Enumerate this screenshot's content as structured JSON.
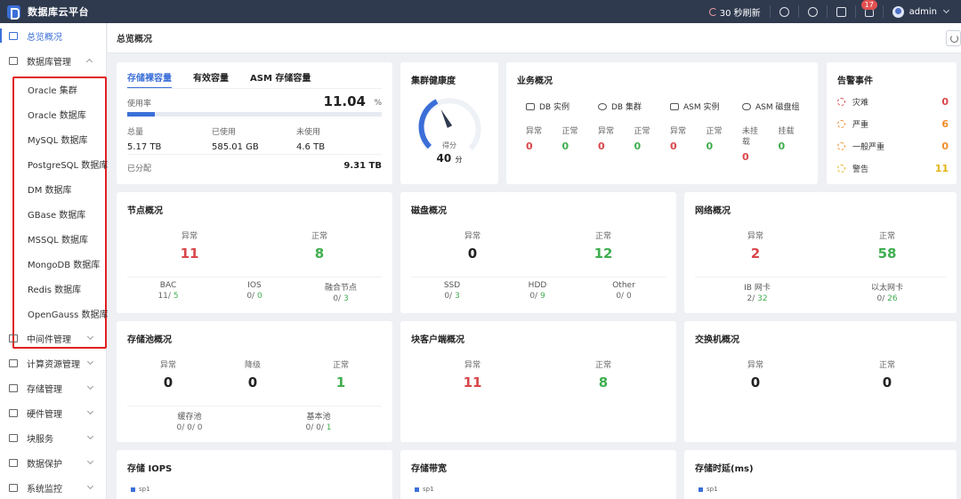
{
  "app": {
    "title": "数据库云平台"
  },
  "topbar": {
    "refresh": "30 秒刷新",
    "badge": "17",
    "user": "admin"
  },
  "sidebar": {
    "items_top": [
      {
        "label": "总览概况",
        "active": true
      },
      {
        "label": "数据库管理",
        "expanded": true
      }
    ],
    "db_submenu": [
      "Oracle 集群",
      "Oracle 数据库",
      "MySQL 数据库",
      "PostgreSQL 数据库",
      "DM 数据库",
      "GBase 数据库",
      "MSSQL 数据库",
      "MongoDB 数据库",
      "Redis 数据库",
      "OpenGauss 数据库"
    ],
    "items_bottom": [
      "中间件管理",
      "计算资源管理",
      "存储管理",
      "硬件管理",
      "块服务",
      "数据保护",
      "系统监控"
    ]
  },
  "main": {
    "title": "总览概况"
  },
  "storage": {
    "tabs": [
      "存储裸容量",
      "有效容量",
      "ASM 存储容量"
    ],
    "usage_label": "使用率",
    "usage_value": "11.04",
    "usage_unit": "%",
    "usage_fraction": 0.11,
    "total_label": "总量",
    "total": "5.17 TB",
    "used_label": "已使用",
    "used": "585.01 GB",
    "unused_label": "未使用",
    "unused": "4.6 TB",
    "alloc_label": "已分配",
    "alloc": "9.31 TB"
  },
  "health": {
    "title": "集群健康度",
    "score_label": "得分",
    "score": "40",
    "unit": "分",
    "score_fraction": 0.4
  },
  "business": {
    "title": "业务概况",
    "groups": [
      "DB 实例",
      "DB 集群",
      "ASM 实例",
      "ASM 磁盘组"
    ],
    "cols": [
      {
        "label": "异常",
        "value": "0",
        "color": "red"
      },
      {
        "label": "正常",
        "value": "0",
        "color": "green"
      },
      {
        "label": "异常",
        "value": "0",
        "color": "red"
      },
      {
        "label": "正常",
        "value": "0",
        "color": "green"
      },
      {
        "label": "异常",
        "value": "0",
        "color": "red"
      },
      {
        "label": "正常",
        "value": "0",
        "color": "green"
      },
      {
        "label": "未挂载",
        "value": "0",
        "color": "red"
      },
      {
        "label": "挂载",
        "value": "0",
        "color": "green"
      }
    ]
  },
  "alerts": {
    "title": "告警事件",
    "items": [
      {
        "label": "灾难",
        "count": "0",
        "color": "#d9464a"
      },
      {
        "label": "严重",
        "count": "6",
        "color": "#f08c2b"
      },
      {
        "label": "一般严重",
        "count": "0",
        "color": "#f08c2b"
      },
      {
        "label": "警告",
        "count": "11",
        "color": "#e3b414"
      }
    ]
  },
  "nodes": {
    "title": "节点概况",
    "abnormal_label": "异常",
    "abnormal": "11",
    "normal_label": "正常",
    "normal": "8",
    "types": [
      {
        "label": "BAC",
        "a": "11",
        "b": "5"
      },
      {
        "label": "IOS",
        "a": "0",
        "b": "0"
      },
      {
        "label": "融合节点",
        "a": "0",
        "b": "3"
      }
    ]
  },
  "disks": {
    "title": "磁盘概况",
    "abnormal_label": "异常",
    "abnormal": "0",
    "normal_label": "正常",
    "normal": "12",
    "types": [
      {
        "label": "SSD",
        "a": "0",
        "b": "3"
      },
      {
        "label": "HDD",
        "a": "0",
        "b": "9"
      },
      {
        "label": "Other",
        "a": "0",
        "b": "0"
      }
    ]
  },
  "network": {
    "title": "网络概况",
    "abnormal_label": "异常",
    "abnormal": "2",
    "normal_label": "正常",
    "normal": "58",
    "types": [
      {
        "label": "IB 网卡",
        "a": "2",
        "b": "32"
      },
      {
        "label": "以太网卡",
        "a": "0",
        "b": "26"
      }
    ]
  },
  "pool": {
    "title": "存储池概况",
    "abnormal_label": "异常",
    "abnormal": "0",
    "degraded_label": "降级",
    "degraded": "0",
    "normal_label": "正常",
    "normal": "1",
    "types": [
      {
        "label": "缓存池",
        "a": "0",
        "b": "0",
        "c": "0"
      },
      {
        "label": "基本池",
        "a": "0",
        "b": "0",
        "c": "1"
      }
    ]
  },
  "clients": {
    "title": "块客户端概况",
    "abnormal_label": "异常",
    "abnormal": "11",
    "normal_label": "正常",
    "normal": "8"
  },
  "switches": {
    "title": "交换机概况",
    "abnormal_label": "异常",
    "abnormal": "0",
    "normal_label": "正常",
    "normal": "0"
  },
  "charts": [
    {
      "title": "存储 IOPS",
      "legend": "sp1"
    },
    {
      "title": "存储带宽",
      "legend": "sp1"
    },
    {
      "title": "存储时延(ms)",
      "legend": "sp1"
    }
  ],
  "colors": {
    "accent": "#3b6fd8",
    "topbar": "#2f3a4f",
    "abnormal": "#d9464a",
    "normal": "#3fae4f",
    "highlight_border": "#e02020"
  }
}
